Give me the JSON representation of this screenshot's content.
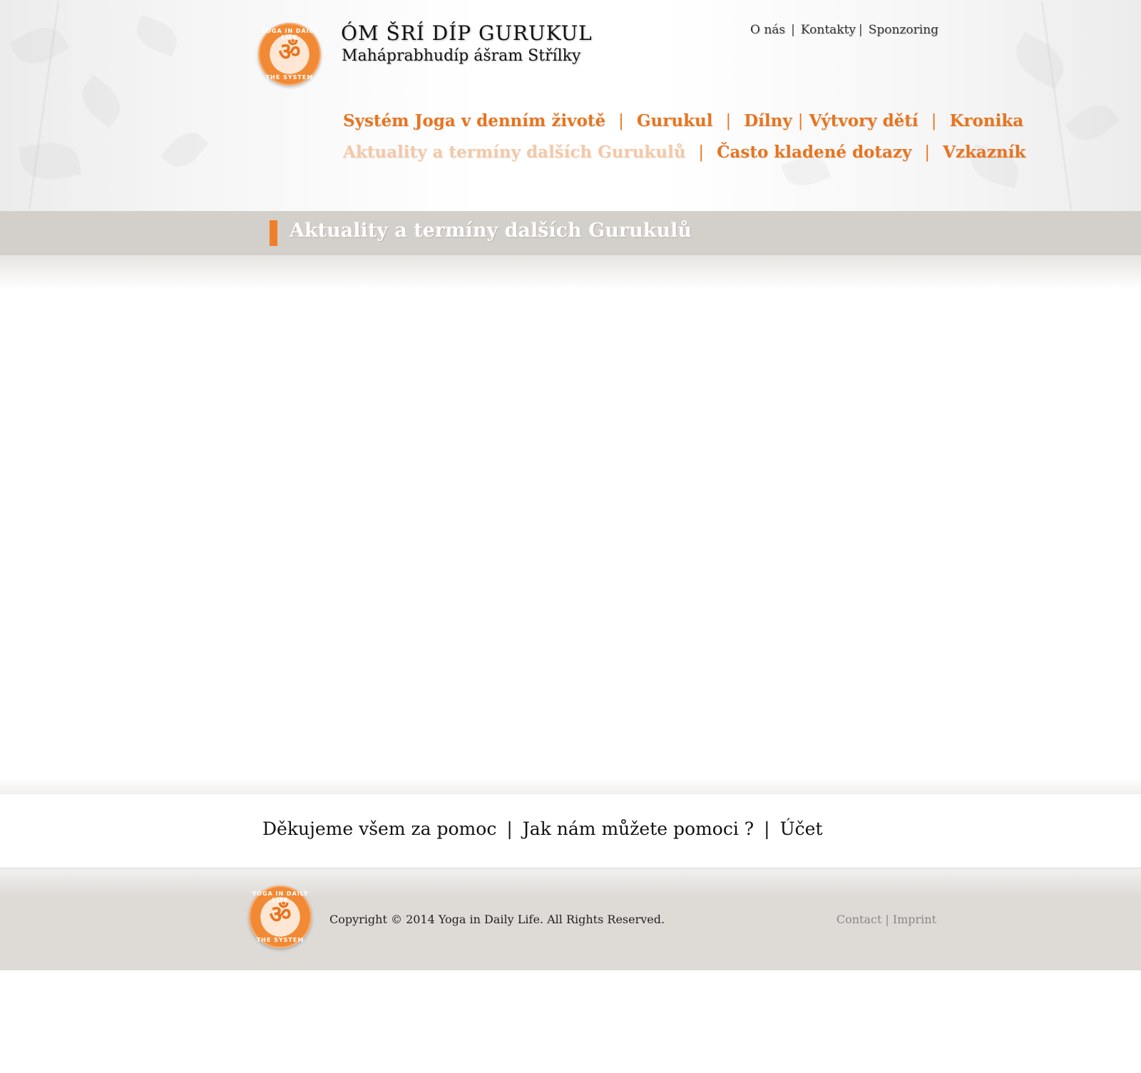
{
  "header": {
    "logo": {
      "symbol": "ॐ",
      "ring_top": "YOGA IN DAILY LIFE",
      "ring_bottom": "THE SYSTEM"
    },
    "title": "ÓM ŠRÍ DÍP GURUKUL",
    "subtitle": "Maháprabhudíp ášram Střílky",
    "top_links": [
      "O nás",
      "Kontakty",
      "Sponzoring"
    ],
    "nav_row1": [
      "Systém Joga v denním životě",
      "Gurukul",
      "Dílny",
      "Výtvory dětí",
      "Kronika"
    ],
    "nav_row2": [
      "Aktuality a termíny dalších Gurukulů",
      "Často kladené dotazy",
      "Vzkazník"
    ],
    "active_nav": "Aktuality a termíny dalších Gurukulů"
  },
  "page": {
    "title": "Aktuality a termíny dalších Gurukulů"
  },
  "footer": {
    "links": [
      "Děkujeme všem za pomoc",
      "Jak nám můžete pomoci ?",
      "Účet"
    ],
    "copyright": "Copyright © 2014 Yoga in Daily Life. All Rights Reserved.",
    "legal_links": [
      "Contact",
      "Imprint"
    ]
  },
  "colors": {
    "accent": "#e8741f",
    "active_nav": "#f5c8a6",
    "titlebar": "#d3cfca",
    "footer_bg": "#dedbd7"
  }
}
